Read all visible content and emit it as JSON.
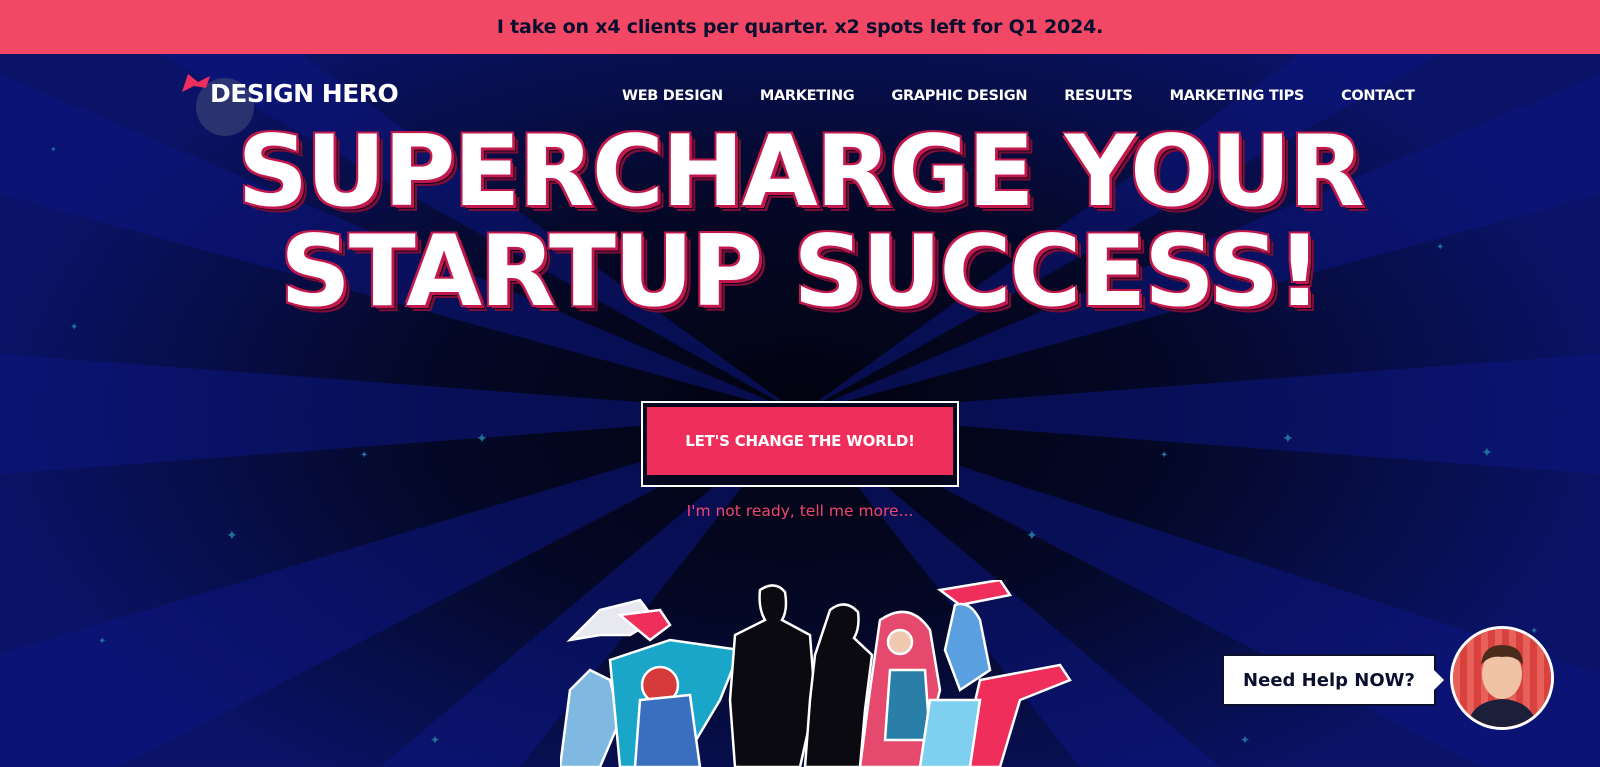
{
  "promo": {
    "text": "I take on x4 clients per quarter. x2 spots left for Q1 2024."
  },
  "header": {
    "logo_text": "DESIGN HERO",
    "nav": [
      {
        "label": "WEB DESIGN"
      },
      {
        "label": "MARKETING"
      },
      {
        "label": "GRAPHIC DESIGN"
      },
      {
        "label": "RESULTS"
      },
      {
        "label": "MARKETING TIPS"
      },
      {
        "label": "CONTACT"
      }
    ]
  },
  "hero": {
    "headline_line1": "SUPERCHARGE YOUR",
    "headline_line2": "STARTUP SUCCESS!",
    "cta_label": "LET'S CHANGE THE WORLD!",
    "secondary_link": "I'm not ready, tell me more..."
  },
  "help_widget": {
    "label": "Need Help NOW?"
  },
  "colors": {
    "accent": "#ef2e5c",
    "promo_bg": "#f24866",
    "navy": "#0a1368",
    "dark": "#05081f"
  },
  "icons": {
    "logo": "cape-icon",
    "avatar": "person-avatar"
  }
}
